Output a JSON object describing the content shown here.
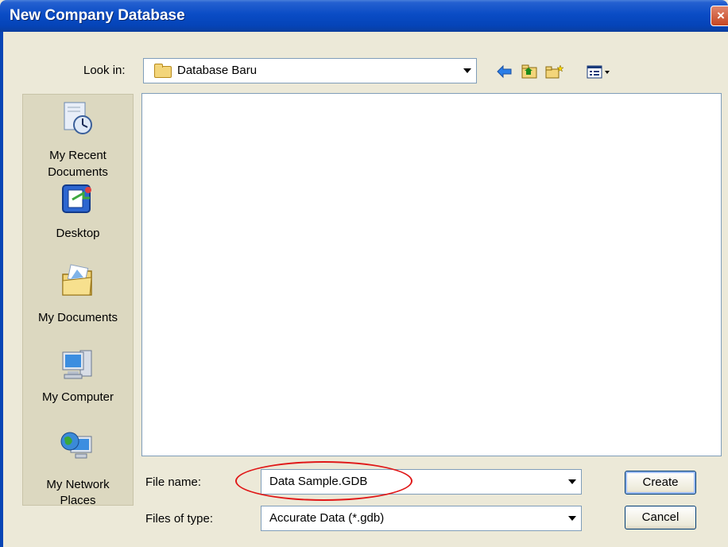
{
  "window": {
    "title": "New Company Database"
  },
  "lookin": {
    "label": "Look in:",
    "value": "Database Baru"
  },
  "toolbar": {
    "back": "back-icon",
    "up": "up-folder-icon",
    "newfolder": "new-folder-icon",
    "view": "view-menu-icon"
  },
  "places": [
    {
      "label_line1": "My Recent",
      "label_line2": "Documents",
      "icon": "recent-documents-icon"
    },
    {
      "label_line1": "Desktop",
      "label_line2": "",
      "icon": "desktop-icon"
    },
    {
      "label_line1": "My Documents",
      "label_line2": "",
      "icon": "my-documents-icon"
    },
    {
      "label_line1": "My Computer",
      "label_line2": "",
      "icon": "my-computer-icon"
    },
    {
      "label_line1": "My Network",
      "label_line2": "Places",
      "icon": "network-places-icon"
    }
  ],
  "filename": {
    "label": "File name:",
    "value": "Data Sample.GDB"
  },
  "filetype": {
    "label": "Files of type:",
    "value": "Accurate Data (*.gdb)"
  },
  "buttons": {
    "create": "Create",
    "cancel": "Cancel"
  },
  "colors": {
    "title_bar": "#0a4cc5",
    "highlight": "#e01818",
    "dialog_bg": "#ece9d8"
  }
}
